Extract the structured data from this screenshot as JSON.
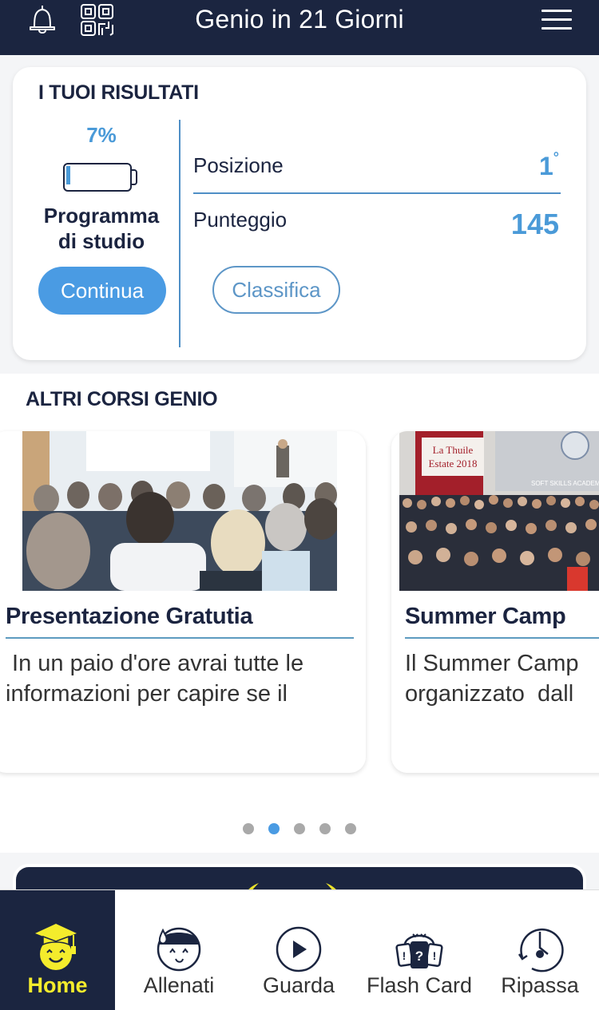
{
  "header": {
    "title": "Genio in 21 Giorni",
    "icons": [
      "bell-icon",
      "qr-code-icon",
      "hamburger-menu-icon"
    ]
  },
  "results": {
    "heading": "I TUOI RISULTATI",
    "progress_label": "7%",
    "progress_fraction": 0.07,
    "program_label_line1": "Programma",
    "program_label_line2": "di studio",
    "continue_button": "Continua",
    "position_label": "Posizione",
    "position_value": "1",
    "position_suffix": "°",
    "score_label": "Punteggio",
    "score_value": "145",
    "leaderboard_button": "Classifica"
  },
  "courses": {
    "heading": "ALTRI CORSI GENIO",
    "items": [
      {
        "title": "Presentazione Gratutia",
        "description": " In un paio d'ore avrai tutte le\ninformazioni per capire se il",
        "image": "seminar-audience-photo"
      },
      {
        "title": "Summer Camp",
        "description": "Il Summer Camp\norganizzato  dall",
        "image": "summer-camp-group-photo",
        "sign_text_line1": "La Thuile",
        "sign_text_line2": "Estate 2018",
        "banner_text": "SOFT SKILLS ACADEMY"
      }
    ],
    "carousel": {
      "count": 5,
      "active_index": 1
    }
  },
  "bottom_nav": {
    "items": [
      {
        "label": "Home",
        "icon": "graduate-smiley-icon",
        "active": true
      },
      {
        "label": "Allenati",
        "icon": "sweating-face-icon",
        "active": false
      },
      {
        "label": "Guarda",
        "icon": "play-circle-icon",
        "active": false
      },
      {
        "label": "Flash Card",
        "icon": "flash-cards-icon",
        "active": false
      },
      {
        "label": "Ripassa",
        "icon": "clock-review-icon",
        "active": false
      }
    ]
  },
  "colors": {
    "navy": "#1b2540",
    "accent_blue": "#4a9be3",
    "active_yellow": "#f4ec2c"
  }
}
